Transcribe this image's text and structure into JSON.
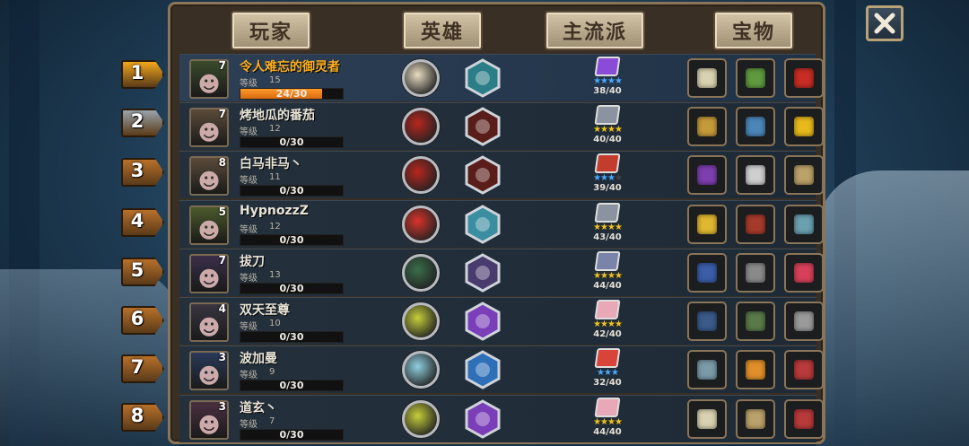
{
  "tabs": [
    "玩家",
    "英雄",
    "主流派",
    "宝物"
  ],
  "close_icon": "close-x-icon",
  "players": [
    {
      "rank": "1",
      "name": "令人难忘的御灵者",
      "level_label": "等级",
      "level": "15",
      "avatar_level": "7",
      "xp": "24/30",
      "xp_frac": 0.8,
      "relic_count": "38/40",
      "relic_stars": 4,
      "relic_stars_total": 4,
      "relic_color": "#8a4cd8",
      "avatar_icon": "goblin-hero-icon",
      "avatar_color": "#3a4b2c",
      "circle_color": "#e9dcc0",
      "hex_color": "#2b7d88",
      "items": [
        {
          "icon": "compass-icon",
          "color": "#d8d2b0"
        },
        {
          "icon": "book-green-icon",
          "color": "#5f9a3e"
        },
        {
          "icon": "red-hood-icon",
          "color": "#c72d24"
        }
      ]
    },
    {
      "rank": "2",
      "name": "烤地瓜的番茄",
      "level_label": "等级",
      "level": "12",
      "avatar_level": "7",
      "xp": "0/30",
      "xp_frac": 0,
      "relic_count": "40/40",
      "relic_stars": 4,
      "relic_stars_total": 4,
      "relic_color": "#8c93a0",
      "avatar_icon": "warrior-icon",
      "avatar_color": "#5a4b3a",
      "circle_color": "#b8261e",
      "hex_color": "#5a1e1a",
      "items": [
        {
          "icon": "staff-icon",
          "color": "#c59a3a"
        },
        {
          "icon": "lantern-icon",
          "color": "#4b86b8"
        },
        {
          "icon": "gold-orb-icon",
          "color": "#e7b91c"
        }
      ]
    },
    {
      "rank": "3",
      "name": "白马非马丶",
      "level_label": "等级",
      "level": "11",
      "avatar_level": "8",
      "xp": "0/30",
      "xp_frac": 0,
      "relic_count": "39/40",
      "relic_stars": 3,
      "relic_stars_total": 4,
      "relic_color": "#c23d2e",
      "avatar_icon": "warrior-icon",
      "avatar_color": "#5a4b3a",
      "circle_color": "#b8261e",
      "hex_color": "#5a1e1a",
      "items": [
        {
          "icon": "spear-purple-icon",
          "color": "#7d3fae"
        },
        {
          "icon": "spear-icon",
          "color": "#cfcfcf"
        },
        {
          "icon": "scales-icon",
          "color": "#bba16a"
        }
      ]
    },
    {
      "rank": "4",
      "name": "HypnozzZ",
      "level_label": "等级",
      "level": "12",
      "avatar_level": "5",
      "xp": "0/30",
      "xp_frac": 0,
      "relic_count": "43/40",
      "relic_stars": 4,
      "relic_stars_total": 4,
      "relic_color": "#8c93a0",
      "avatar_icon": "orc-icon",
      "avatar_color": "#4b5a2a",
      "circle_color": "#d9342a",
      "hex_color": "#3a8ea0",
      "items": [
        {
          "icon": "goblet-icon",
          "color": "#e0b730"
        },
        {
          "icon": "red-beast-icon",
          "color": "#a63a2a"
        },
        {
          "icon": "anchor-icon",
          "color": "#6aa0b0"
        }
      ]
    },
    {
      "rank": "5",
      "name": "拔刀",
      "level_label": "等级",
      "level": "13",
      "avatar_level": "7",
      "xp": "0/30",
      "xp_frac": 0,
      "relic_count": "44/40",
      "relic_stars": 4,
      "relic_stars_total": 4,
      "relic_color": "#7a84a8",
      "avatar_icon": "hooded-mage-icon",
      "avatar_color": "#3a2f4a",
      "circle_color": "#3a6e4a",
      "hex_color": "#4a3b6e",
      "items": [
        {
          "icon": "blue-crystal-icon",
          "color": "#3a5ea8"
        },
        {
          "icon": "spellbook-icon",
          "color": "#8a8a8a"
        },
        {
          "icon": "potion-icon",
          "color": "#d8405a"
        }
      ]
    },
    {
      "rank": "6",
      "name": "双天至尊",
      "level_label": "等级",
      "level": "10",
      "avatar_level": "4",
      "xp": "0/30",
      "xp_frac": 0,
      "relic_count": "42/40",
      "relic_stars": 4,
      "relic_stars_total": 4,
      "relic_color": "#e9a8b8",
      "avatar_icon": "sorceress-icon",
      "avatar_color": "#3a3540",
      "circle_color": "#c6cf3a",
      "hex_color": "#7a3fb8",
      "items": [
        {
          "icon": "chest-icon",
          "color": "#3a5a8a"
        },
        {
          "icon": "scroll-quill-icon",
          "color": "#5a7a4a"
        },
        {
          "icon": "rod-icon",
          "color": "#9a9a9a"
        }
      ]
    },
    {
      "rank": "7",
      "name": "波加曼",
      "level_label": "等级",
      "level": "9",
      "avatar_level": "3",
      "xp": "0/30",
      "xp_frac": 0,
      "relic_count": "32/40",
      "relic_stars": 3,
      "relic_stars_total": 3,
      "relic_color": "#d8443a",
      "avatar_icon": "ice-knight-icon",
      "avatar_color": "#2a3a5a",
      "circle_color": "#8fd0e0",
      "hex_color": "#2e6fb8",
      "items": [
        {
          "icon": "claw-icon",
          "color": "#7a9aa8"
        },
        {
          "icon": "amber-icon",
          "color": "#e0902a"
        },
        {
          "icon": "red-tome-icon",
          "color": "#b83a3a"
        }
      ]
    },
    {
      "rank": "8",
      "name": "道玄丶",
      "level_label": "等级",
      "level": "7",
      "avatar_level": "3",
      "xp": "0/30",
      "xp_frac": 0,
      "relic_count": "44/40",
      "relic_stars": 4,
      "relic_stars_total": 4,
      "relic_color": "#e9a8b8",
      "avatar_icon": "dryad-icon",
      "avatar_color": "#4a3040",
      "circle_color": "#c6cf3a",
      "hex_color": "#7a3fb8",
      "items": [
        {
          "icon": "compass-icon",
          "color": "#d8d2b0"
        },
        {
          "icon": "scales-icon",
          "color": "#bba16a"
        },
        {
          "icon": "red-tome-icon",
          "color": "#b83a3a"
        }
      ]
    }
  ],
  "rank_colors": [
    "#f2a81c",
    "#9aa4ad",
    "#b8702a",
    "#b8702a",
    "#b8702a",
    "#b8702a",
    "#b8702a",
    "#b8702a"
  ]
}
